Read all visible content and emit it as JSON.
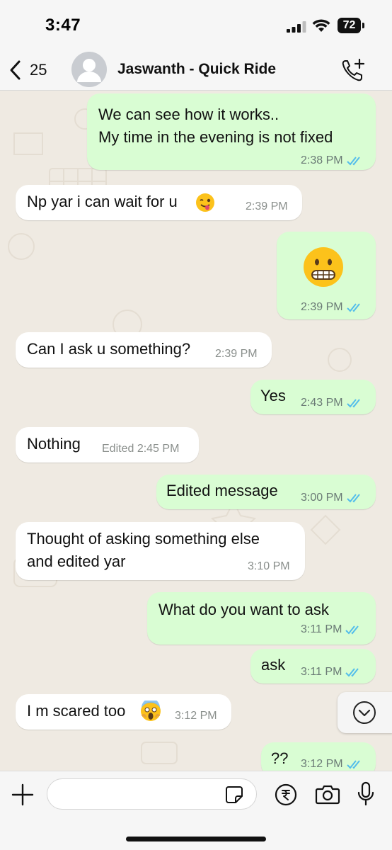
{
  "status_bar": {
    "time": "3:47",
    "battery": "72"
  },
  "header": {
    "back_count": "25",
    "contact_name": "Jaswanth - Quick Ride"
  },
  "messages": [
    {
      "dir": "out",
      "lines": [
        "We can see how it works..",
        "My time in the evening is not fixed"
      ],
      "time": "2:38 PM"
    },
    {
      "dir": "in",
      "text": "Np yar i can wait for u",
      "time": "2:39 PM",
      "emoji": "winking-face-with-tongue"
    },
    {
      "dir": "out",
      "emoji": "grimacing-face",
      "time": "2:39 PM"
    },
    {
      "dir": "in",
      "text": "Can I ask u something?",
      "time": "2:39 PM"
    },
    {
      "dir": "out",
      "text": "Yes",
      "time": "2:43 PM"
    },
    {
      "dir": "in",
      "text": "Nothing",
      "time": "Edited 2:45 PM"
    },
    {
      "dir": "out",
      "text": "Edited message",
      "time": "3:00 PM"
    },
    {
      "dir": "in",
      "lines": [
        "Thought of asking something else",
        "and edited yar"
      ],
      "time": "3:10 PM"
    },
    {
      "dir": "out",
      "text": "What do you want to ask",
      "time": "3:11 PM"
    },
    {
      "dir": "out",
      "text": "ask",
      "time": "3:11 PM"
    },
    {
      "dir": "in",
      "text": "I m scared too",
      "time": "3:12 PM",
      "emoji": "face-screaming-in-fear"
    },
    {
      "dir": "out",
      "text": "??",
      "time": "3:12 PM"
    }
  ],
  "input": {
    "placeholder": ""
  },
  "colors": {
    "outgoing": "#d9fdd3",
    "incoming": "#ffffff",
    "read_ticks": "#53bdeb",
    "background": "#efeae2"
  }
}
